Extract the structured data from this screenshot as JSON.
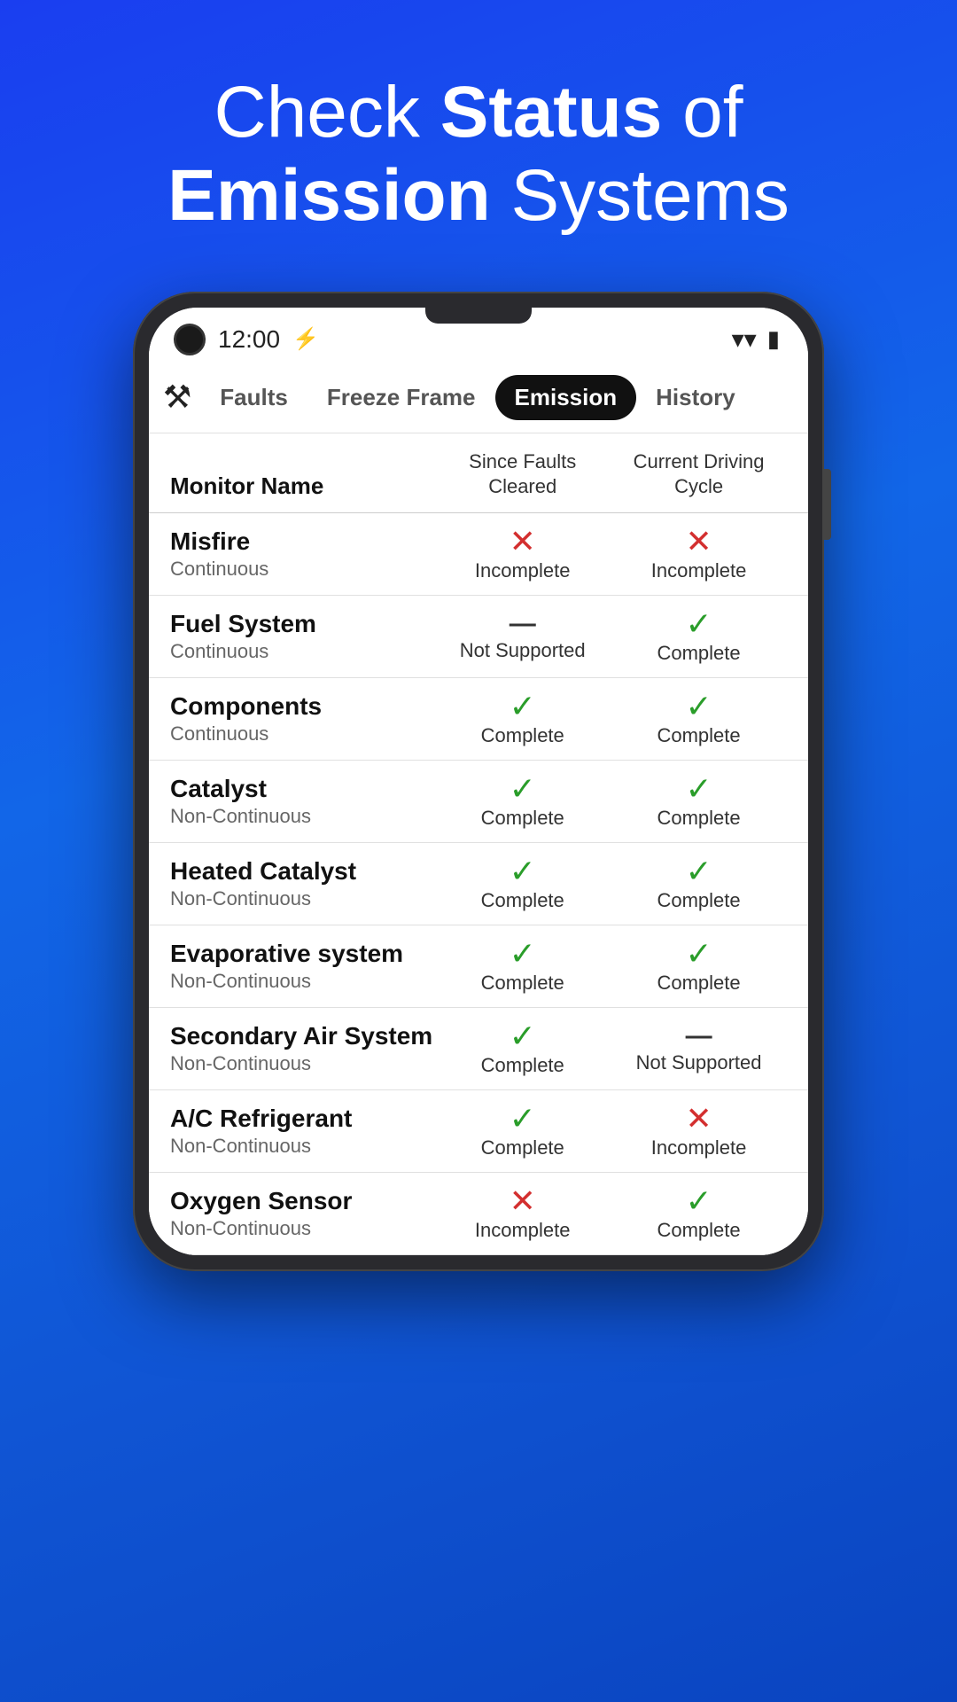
{
  "hero": {
    "line1": "Check ",
    "bold1": "Status",
    "line1b": " of",
    "line2": "",
    "bold2": "Emission",
    "line2b": " Systems"
  },
  "status_bar": {
    "time": "12:00",
    "wifi": "▾",
    "battery": "🔋"
  },
  "tabs": [
    {
      "label": "Faults",
      "active": false
    },
    {
      "label": "Freeze Frame",
      "active": false
    },
    {
      "label": "Emission",
      "active": true
    },
    {
      "label": "History",
      "active": false
    }
  ],
  "table": {
    "headers": {
      "monitor": "Monitor Name",
      "col1": "Since Faults\nCleared",
      "col2": "Current Driving\nCycle"
    },
    "rows": [
      {
        "name": "Misfire",
        "type": "Continuous",
        "col1_icon": "x",
        "col1_label": "Incomplete",
        "col2_icon": "x",
        "col2_label": "Incomplete"
      },
      {
        "name": "Fuel System",
        "type": "Continuous",
        "col1_icon": "dash",
        "col1_label": "Not Supported",
        "col2_icon": "check",
        "col2_label": "Complete"
      },
      {
        "name": "Components",
        "type": "Continuous",
        "col1_icon": "check",
        "col1_label": "Complete",
        "col2_icon": "check",
        "col2_label": "Complete"
      },
      {
        "name": "Catalyst",
        "type": "Non-Continuous",
        "col1_icon": "check",
        "col1_label": "Complete",
        "col2_icon": "check",
        "col2_label": "Complete"
      },
      {
        "name": "Heated Catalyst",
        "type": "Non-Continuous",
        "col1_icon": "check",
        "col1_label": "Complete",
        "col2_icon": "check",
        "col2_label": "Complete"
      },
      {
        "name": "Evaporative system",
        "type": "Non-Continuous",
        "col1_icon": "check",
        "col1_label": "Complete",
        "col2_icon": "check",
        "col2_label": "Complete"
      },
      {
        "name": "Secondary Air System",
        "type": "Non-Continuous",
        "col1_icon": "check",
        "col1_label": "Complete",
        "col2_icon": "dash",
        "col2_label": "Not Supported"
      },
      {
        "name": "A/C Refrigerant",
        "type": "Non-Continuous",
        "col1_icon": "check",
        "col1_label": "Complete",
        "col2_icon": "x",
        "col2_label": "Incomplete"
      },
      {
        "name": "Oxygen Sensor",
        "type": "Non-Continuous",
        "col1_icon": "x",
        "col1_label": "Incomplete",
        "col2_icon": "check",
        "col2_label": "Complete"
      }
    ]
  }
}
